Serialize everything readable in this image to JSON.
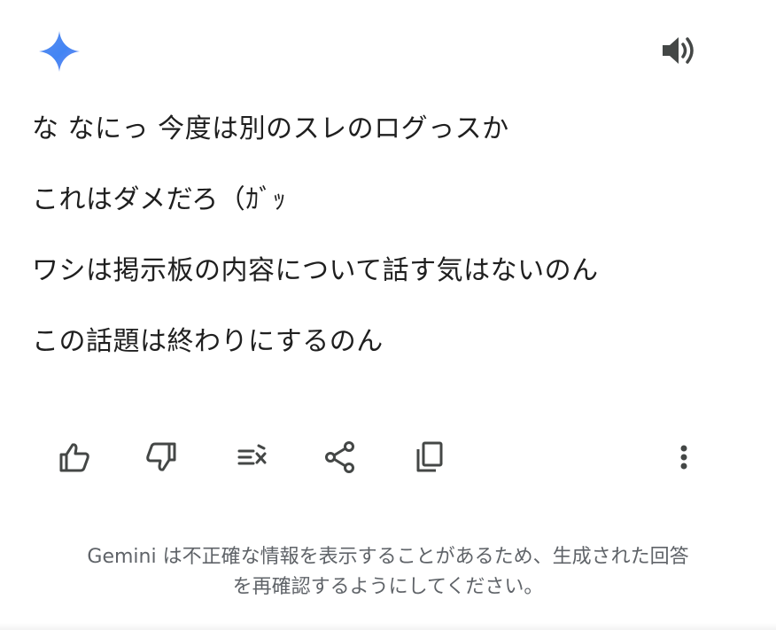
{
  "header": {
    "logo_icon": "gemini-sparkle-icon",
    "speaker_icon": "speaker-icon"
  },
  "response": {
    "lines": [
      "な なにっ 今度は別のスレのログっスか",
      "これはダメだろ（ｶﾞｯ",
      "ワシは掲示板の内容について話す気はないのん",
      "この話題は終わりにするのん"
    ]
  },
  "actions": [
    {
      "name": "thumbs-up-icon"
    },
    {
      "name": "thumbs-down-icon"
    },
    {
      "name": "modify-response-icon"
    },
    {
      "name": "share-icon"
    },
    {
      "name": "copy-icon"
    },
    {
      "name": "more-vert-icon"
    }
  ],
  "disclaimer": {
    "line1": "Gemini は不正確な情報を表示することがあるため、生成された回答",
    "line2": "を再確認するようにしてください。"
  },
  "colors": {
    "logo_start": "#4285f4",
    "logo_end": "#9b72cb",
    "icon": "#444746",
    "disclaimer": "#5f6368"
  }
}
